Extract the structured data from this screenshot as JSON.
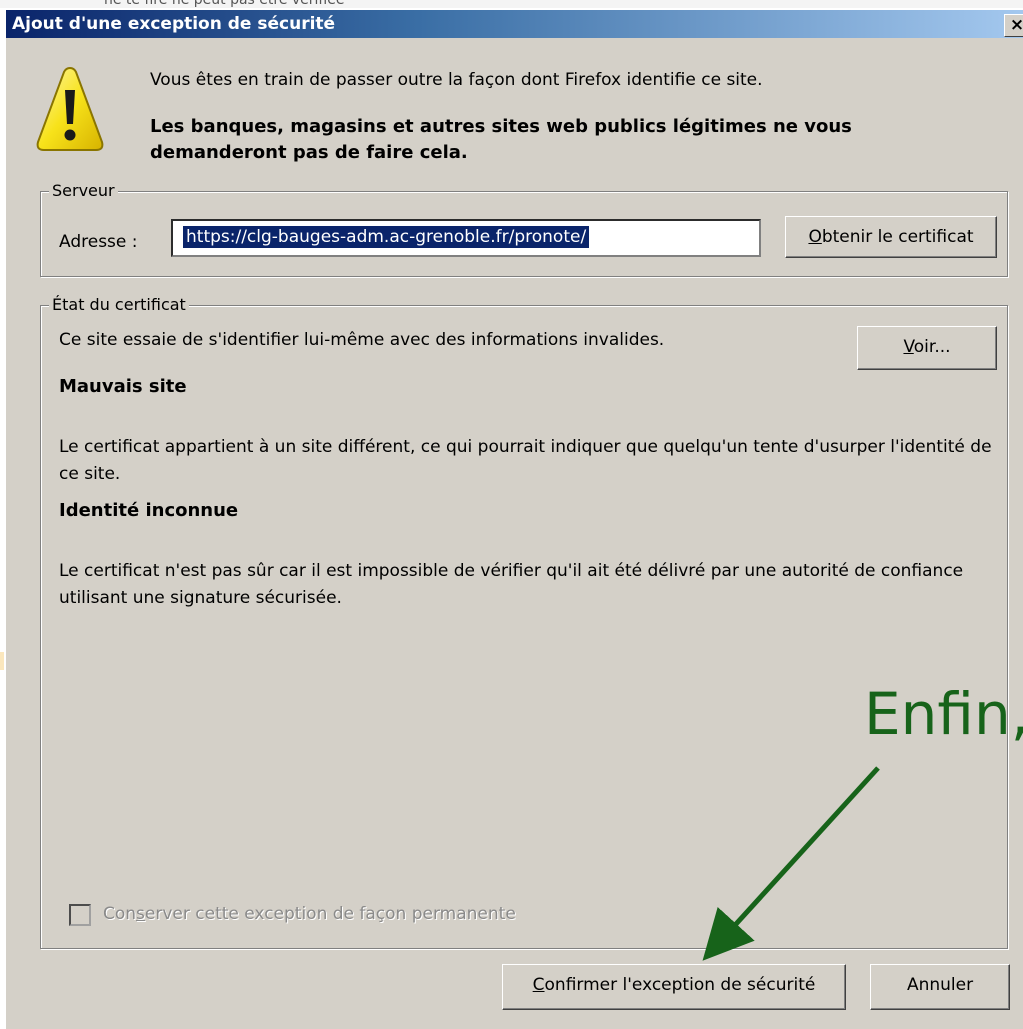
{
  "background": {
    "partial_text": "ne te fire ne peut pas être vérifiée"
  },
  "dialog": {
    "title": "Ajout d'une exception de sécurité",
    "close_label": "×",
    "warning_icon": "warning-triangle-icon",
    "message_line": "Vous êtes en train de passer outre la façon dont Firefox identifie ce site.",
    "message_bold": "Les banques, magasins et autres sites web publics légitimes ne vous demanderont pas de faire cela."
  },
  "server": {
    "legend": "Serveur",
    "address_label": "Adresse :",
    "address_value": "https://clg-bauges-adm.ac-grenoble.fr/pronote/",
    "get_cert_prefix": "",
    "get_cert_mnemonic": "O",
    "get_cert_rest": "btenir le certificat"
  },
  "certificate": {
    "legend": "État du certificat",
    "description": "Ce site essaie de s'identifier lui-même avec des informations invalides.",
    "view_mnemonic": "V",
    "view_rest": "oir...",
    "sections": [
      {
        "title": "Mauvais site",
        "text": "Le certificat appartient à un site différent, ce qui pourrait indiquer que quelqu'un tente d'usurper l'identité de ce site."
      },
      {
        "title": "Identité inconnue",
        "text": "Le certificat n'est pas sûr car il est impossible de vérifier qu'il ait été délivré par une autorité de confiance utilisant une signature sécurisée."
      }
    ]
  },
  "permanent": {
    "label_prefix": "Con",
    "label_mnemonic": "s",
    "label_rest": "erver cette exception de façon permanente",
    "checked": false,
    "enabled": false
  },
  "buttons": {
    "confirm_mnemonic": "C",
    "confirm_rest": "onfirmer l'exception de sécurité",
    "cancel": "Annuler"
  },
  "annotation": {
    "text": "Enfin,",
    "color": "#17631a"
  },
  "colors": {
    "dialog_bg": "#d4d0c8",
    "title_bar": "#0a246a",
    "selection": "#0a246a",
    "disabled_text": "#8a8a8a"
  }
}
